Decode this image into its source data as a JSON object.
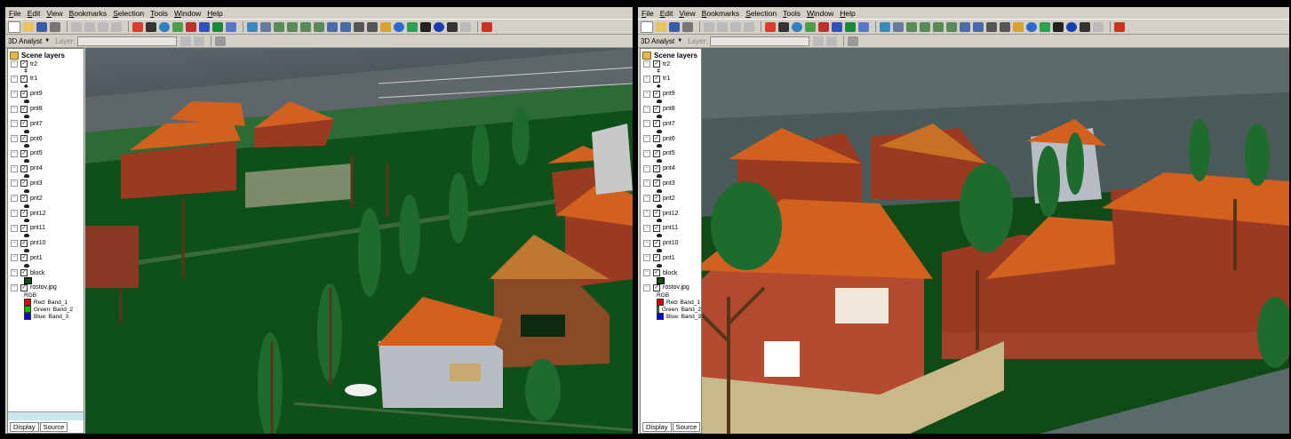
{
  "menu": [
    "File",
    "Edit",
    "View",
    "Bookmarks",
    "Selection",
    "Tools",
    "Window",
    "Help"
  ],
  "toolbar2": {
    "analyst": "3D Analyst",
    "layer_label": "Layer:"
  },
  "toc": {
    "title": "Scene layers",
    "layers": [
      "tr2",
      "tr1",
      "pnt9",
      "pnt8",
      "pnt7",
      "pnt6",
      "pnt5",
      "pnt4",
      "pnt3",
      "pnt2",
      "pnt12",
      "pnt11",
      "pnt10",
      "pnt1",
      "block",
      "rostov.jpg"
    ],
    "raster": {
      "mode": "RGB",
      "bands": [
        {
          "label": "Red:",
          "value": "Band_1",
          "color": "#e00000"
        },
        {
          "label": "Green:",
          "value": "Band_2",
          "color": "#00c000"
        },
        {
          "label": "Blue:",
          "value": "Band_3",
          "color": "#0000e0"
        }
      ]
    }
  },
  "tabs": {
    "display": "Display",
    "source": "Source"
  },
  "colors": {
    "grass": "#0d4a16",
    "roof": "#d2601e",
    "wall": "#9a3a22",
    "road": "#5f666a"
  }
}
